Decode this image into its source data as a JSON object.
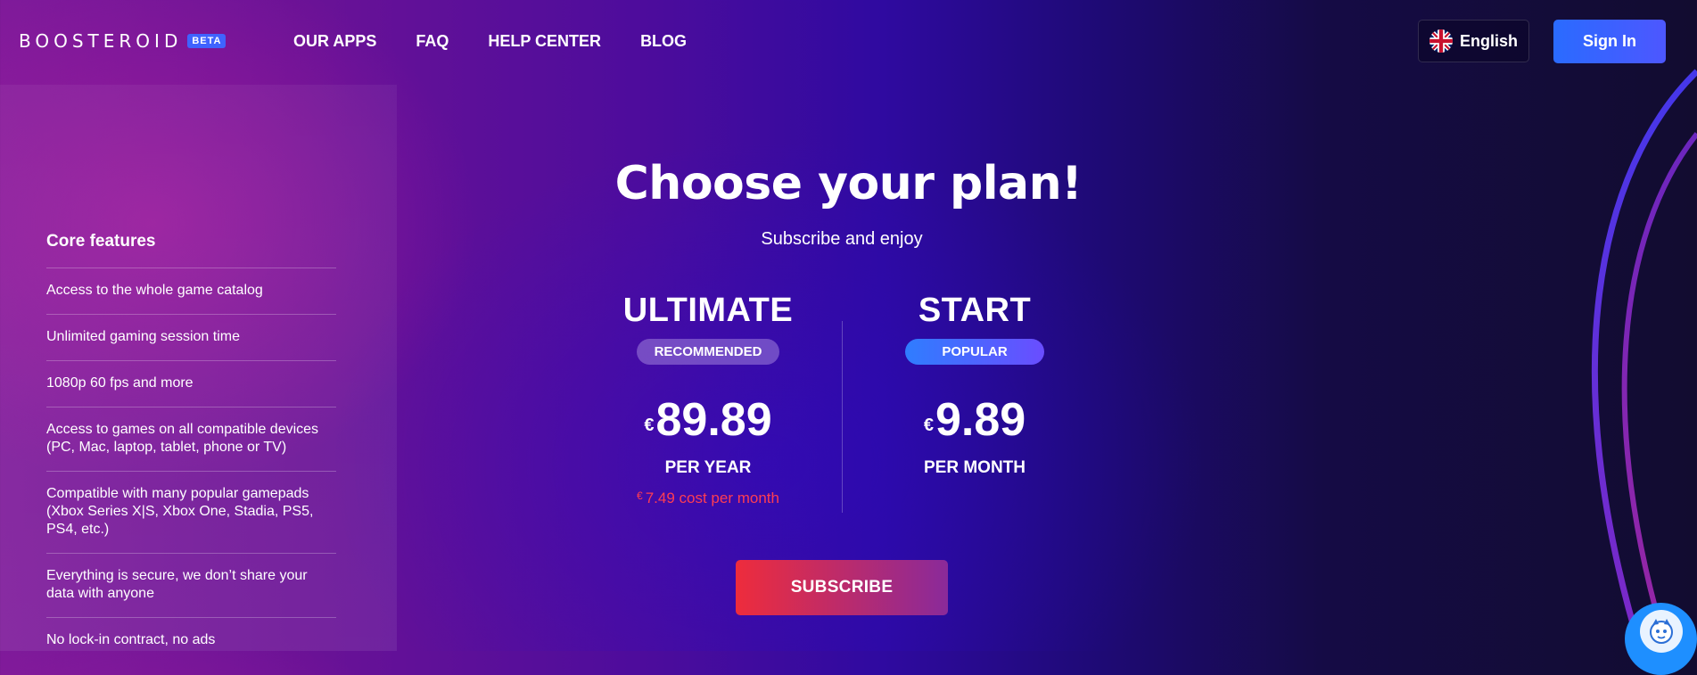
{
  "header": {
    "logo_text": "BOOSTEROID",
    "logo_badge": "BETA",
    "nav": [
      {
        "label": "OUR APPS"
      },
      {
        "label": "FAQ"
      },
      {
        "label": "HELP CENTER"
      },
      {
        "label": "BLOG"
      }
    ],
    "language_label": "English",
    "signin_label": "Sign In"
  },
  "sidebar": {
    "title": "Core features",
    "features": [
      {
        "text": "Access to the whole game catalog"
      },
      {
        "text": "Unlimited gaming session time"
      },
      {
        "text": "1080p 60 fps and more"
      },
      {
        "text": "Access to games on all compatible devices (PC, Mac, laptop, tablet, phone or TV)"
      },
      {
        "text": "Compatible with many popular gamepads (Xbox Series X|S, Xbox One, Stadia, PS5, PS4, etc.)"
      },
      {
        "text": "Everything is secure, we don’t share your data with anyone"
      },
      {
        "text": "No lock-in contract, no ads"
      }
    ]
  },
  "main": {
    "heading": "Choose your plan!",
    "subtitle": "Subscribe and enjoy",
    "plans": [
      {
        "name": "ULTIMATE",
        "badge": "RECOMMENDED",
        "currency": "€",
        "price": "89.89",
        "period": "PER YEAR",
        "monthly_currency": "€",
        "monthly_note": "7.49  cost per month"
      },
      {
        "name": "START",
        "badge": "POPULAR",
        "currency": "€",
        "price": "9.89",
        "period": "PER MONTH"
      }
    ],
    "subscribe_label": "SUBSCRIBE"
  },
  "colors": {
    "accent_blue": "#2a6bff",
    "price_red": "#ff3d52",
    "subscribe_start": "#ee2c3c",
    "subscribe_end": "#8a2a9a"
  },
  "icons": {
    "language": "uk-flag-icon",
    "support": "support-avatar-icon"
  }
}
